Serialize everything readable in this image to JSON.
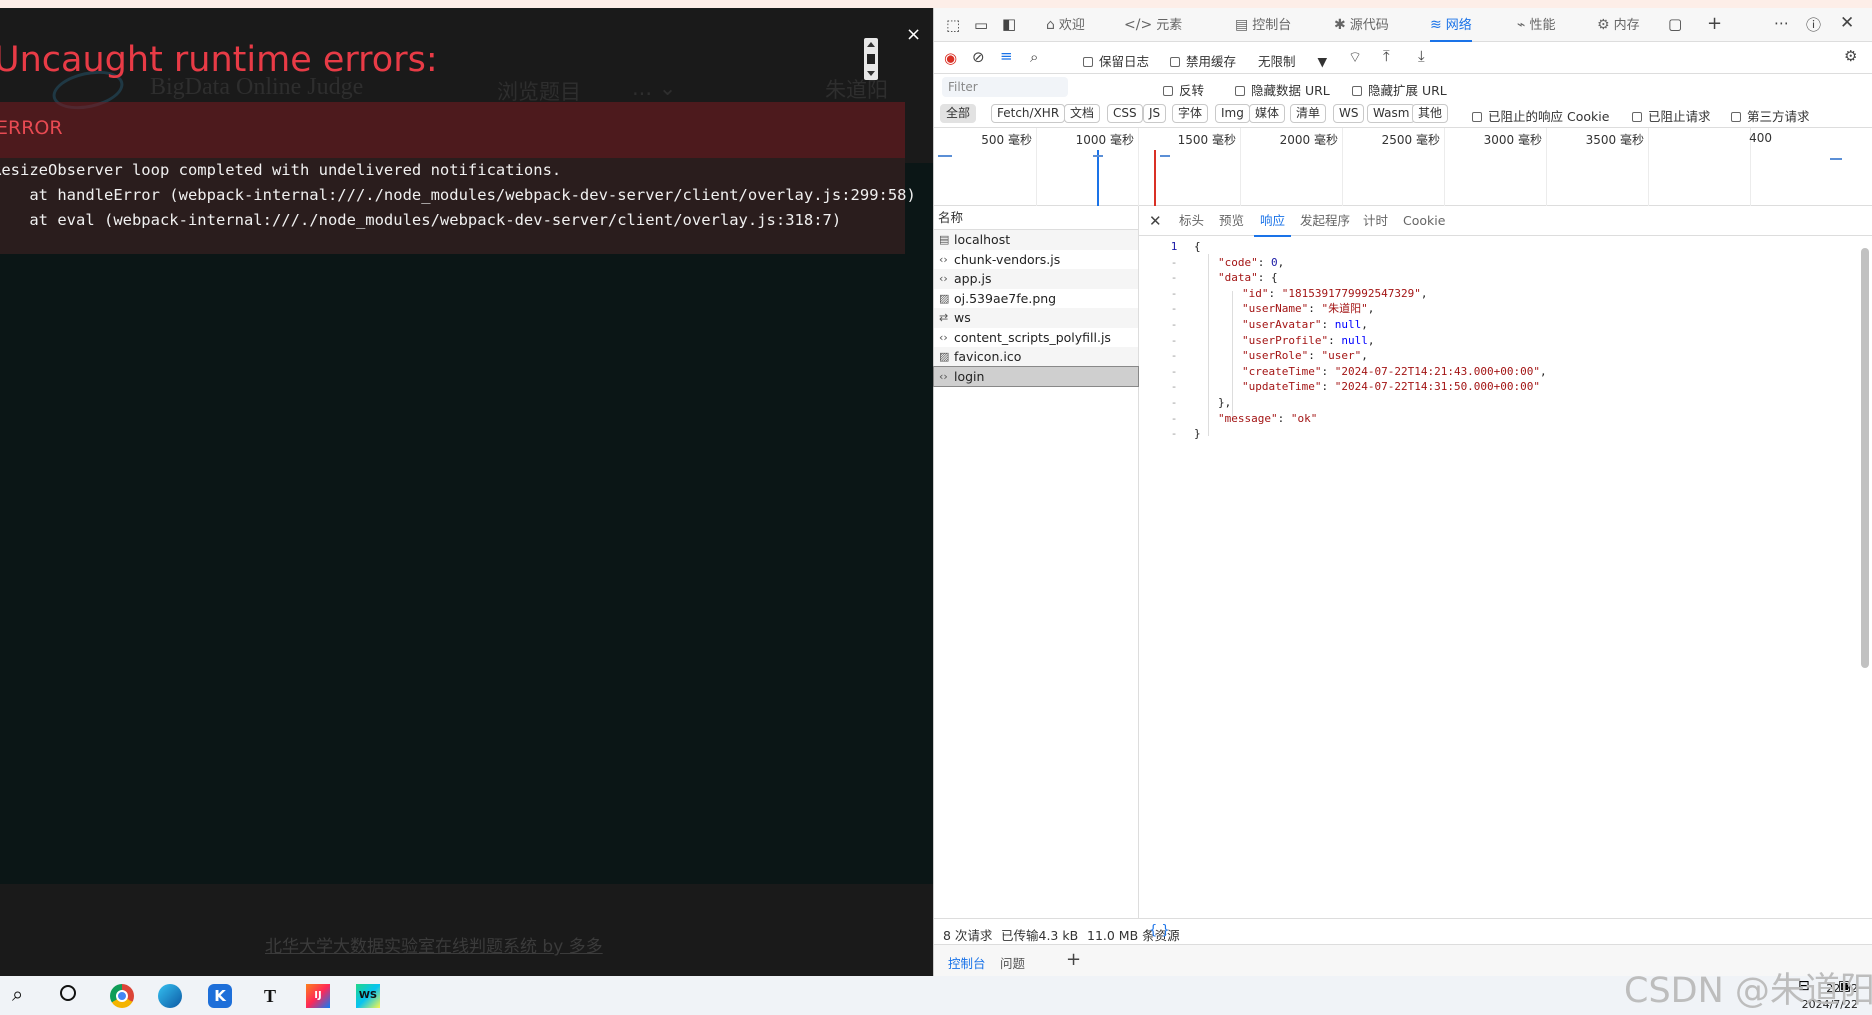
{
  "app": {
    "site_title": "BigData Online Judge",
    "nav_browse": "浏览题目",
    "nav_more": "...",
    "user_name": "朱道阳",
    "footer": "北华大学大数据实验室在线判题系统 by 多多"
  },
  "overlay": {
    "title": "Uncaught runtime errors:",
    "close": "×",
    "error_label": "ERROR",
    "message_lines": [
      "ResizeObserver loop completed with undelivered notifications.",
      "    at handleError (webpack-internal:///./node_modules/webpack-dev-server/client/overlay.js:299:58)",
      "    at eval (webpack-internal:///./node_modules/webpack-dev-server/client/overlay.js:318:7)"
    ]
  },
  "devtools": {
    "tabs": [
      {
        "label": "欢迎",
        "icon": "home-icon"
      },
      {
        "label": "元素",
        "icon": "code-icon"
      },
      {
        "label": "控制台",
        "icon": "console-icon"
      },
      {
        "label": "源代码",
        "icon": "bug-icon"
      },
      {
        "label": "网络",
        "icon": "wifi-icon",
        "active": true
      },
      {
        "label": "性能",
        "icon": "performance-icon"
      },
      {
        "label": "内存",
        "icon": "memory-icon"
      }
    ],
    "toolbar": {
      "preserve_log": "保留日志",
      "disable_cache": "禁用缓存",
      "throttle": "无限制"
    },
    "filter": {
      "placeholder": "Filter",
      "invert": "反转",
      "hide_data_urls": "隐藏数据 URL",
      "hide_ext_urls": "隐藏扩展 URL"
    },
    "type_filters": [
      "全部",
      "Fetch/XHR",
      "文档",
      "CSS",
      "JS",
      "字体",
      "Img",
      "媒体",
      "清单",
      "WS",
      "Wasm",
      "其他"
    ],
    "type_active": "全部",
    "extra_checks": [
      "已阻止的响应 Cookie",
      "已阻止请求",
      "第三方请求"
    ],
    "timeline_ticks": [
      "500 毫秒",
      "1000 毫秒",
      "1500 毫秒",
      "2000 毫秒",
      "2500 毫秒",
      "3000 毫秒",
      "3500 毫秒",
      "400"
    ],
    "name_header": "名称",
    "requests": [
      {
        "name": "localhost",
        "icon": "document-icon"
      },
      {
        "name": "chunk-vendors.js",
        "icon": "script-icon"
      },
      {
        "name": "app.js",
        "icon": "script-icon"
      },
      {
        "name": "oj.539ae7fe.png",
        "icon": "image-icon"
      },
      {
        "name": "ws",
        "icon": "websocket-icon"
      },
      {
        "name": "content_scripts_polyfill.js",
        "icon": "script-icon"
      },
      {
        "name": "favicon.ico",
        "icon": "image-icon"
      },
      {
        "name": "login",
        "icon": "fetch-icon",
        "selected": true
      }
    ],
    "detail_tabs": [
      "标头",
      "预览",
      "响应",
      "发起程序",
      "计时",
      "Cookie"
    ],
    "detail_active": "响应",
    "response_lines": [
      {
        "ln": "1",
        "indent": 0,
        "parts": [
          [
            "p",
            "{"
          ]
        ]
      },
      {
        "ln": "-",
        "indent": 1,
        "parts": [
          [
            "k",
            "\"code\""
          ],
          [
            "p",
            ": "
          ],
          [
            "n",
            "0"
          ],
          [
            "p",
            ","
          ]
        ]
      },
      {
        "ln": "-",
        "indent": 1,
        "parts": [
          [
            "k",
            "\"data\""
          ],
          [
            "p",
            ": {"
          ]
        ]
      },
      {
        "ln": "-",
        "indent": 2,
        "parts": [
          [
            "k",
            "\"id\""
          ],
          [
            "p",
            ": "
          ],
          [
            "s",
            "\"1815391779992547329\""
          ],
          [
            "p",
            ","
          ]
        ]
      },
      {
        "ln": "-",
        "indent": 2,
        "parts": [
          [
            "k",
            "\"userName\""
          ],
          [
            "p",
            ": "
          ],
          [
            "s",
            "\"朱道阳\""
          ],
          [
            "p",
            ","
          ]
        ]
      },
      {
        "ln": "-",
        "indent": 2,
        "parts": [
          [
            "k",
            "\"userAvatar\""
          ],
          [
            "p",
            ": "
          ],
          [
            "kw",
            "null"
          ],
          [
            "p",
            ","
          ]
        ]
      },
      {
        "ln": "-",
        "indent": 2,
        "parts": [
          [
            "k",
            "\"userProfile\""
          ],
          [
            "p",
            ": "
          ],
          [
            "kw",
            "null"
          ],
          [
            "p",
            ","
          ]
        ]
      },
      {
        "ln": "-",
        "indent": 2,
        "parts": [
          [
            "k",
            "\"userRole\""
          ],
          [
            "p",
            ": "
          ],
          [
            "s",
            "\"user\""
          ],
          [
            "p",
            ","
          ]
        ]
      },
      {
        "ln": "-",
        "indent": 2,
        "parts": [
          [
            "k",
            "\"createTime\""
          ],
          [
            "p",
            ": "
          ],
          [
            "s",
            "\"2024-07-22T14:21:43.000+00:00\""
          ],
          [
            "p",
            ","
          ]
        ]
      },
      {
        "ln": "-",
        "indent": 2,
        "parts": [
          [
            "k",
            "\"updateTime\""
          ],
          [
            "p",
            ": "
          ],
          [
            "s",
            "\"2024-07-22T14:31:50.000+00:00\""
          ]
        ]
      },
      {
        "ln": "-",
        "indent": 1,
        "parts": [
          [
            "p",
            "},"
          ]
        ]
      },
      {
        "ln": "-",
        "indent": 1,
        "parts": [
          [
            "k",
            "\"message\""
          ],
          [
            "p",
            ": "
          ],
          [
            "s",
            "\"ok\""
          ]
        ]
      },
      {
        "ln": "-",
        "indent": 0,
        "parts": [
          [
            "p",
            "}"
          ]
        ]
      }
    ],
    "status": {
      "requests": "8 次请求",
      "transferred": "已传输4.3 kB",
      "resources": "11.0 MB 条资源",
      "pretty": "{ }"
    },
    "drawer_tabs": [
      "控制台",
      "问题"
    ],
    "drawer_active": "控制台"
  },
  "taskbar": {
    "time": "22:32",
    "date": "2024/7/22"
  },
  "watermark": "CSDN @朱道阳",
  "colors": {
    "accent": "#1a73e8",
    "error_red": "#e83b46",
    "overlay_bg": "#0b1616"
  }
}
